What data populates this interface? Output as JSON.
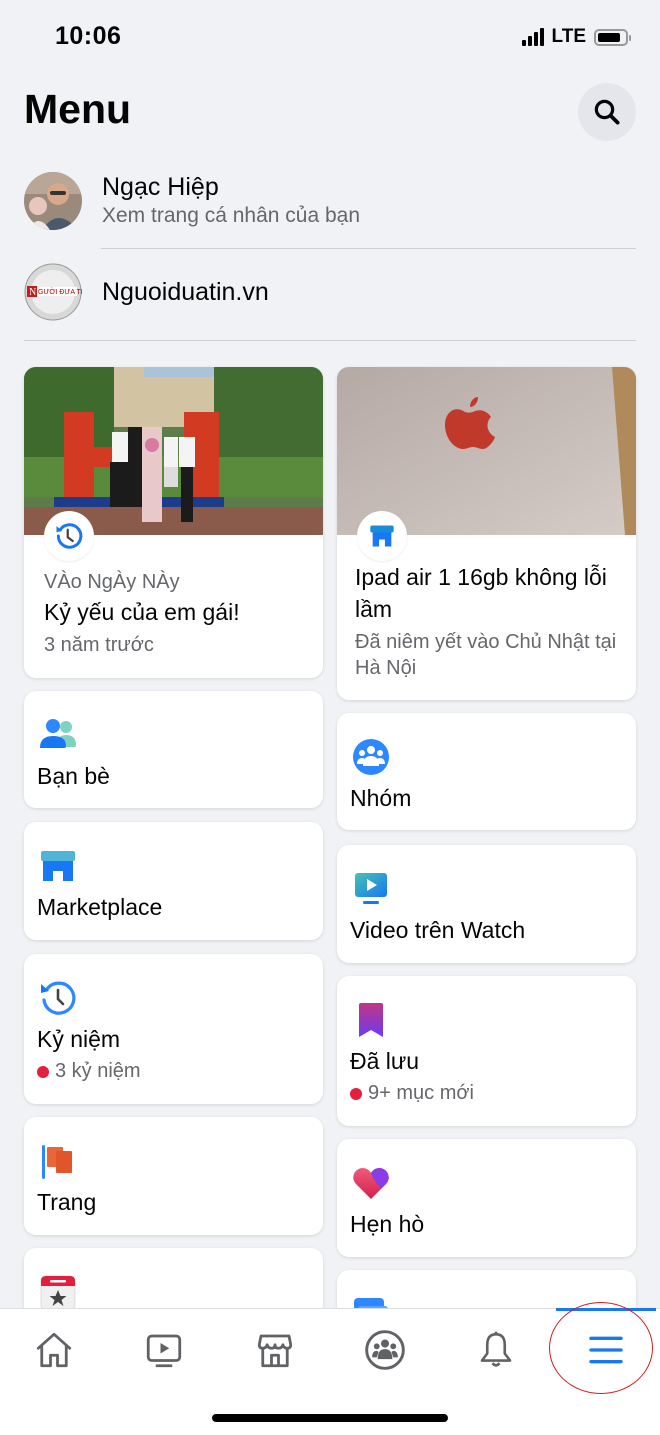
{
  "status_bar": {
    "time": "10:06",
    "network": "LTE",
    "battery_level": 0.85
  },
  "header": {
    "title": "Menu",
    "search_icon": "search-icon"
  },
  "profile": {
    "name": "Ngạc Hiệp",
    "subtitle": "Xem trang cá nhân của bạn"
  },
  "page": {
    "name": "Nguoiduatin.vn"
  },
  "featured": {
    "memory": {
      "eyebrow": "VÀo NgÀy NÀy",
      "title": "Kỷ yếu của em gái!",
      "sub": "3 năm trước",
      "icon": "memories-clock-icon"
    },
    "marketplace": {
      "title": "Ipad air 1 16gb không lỗi lầm",
      "sub": "Đã niêm yết vào Chủ Nhật tại Hà Nội",
      "icon": "marketplace-shop-icon"
    }
  },
  "shortcuts_left": [
    {
      "label": "Bạn bè",
      "icon": "friends-icon"
    },
    {
      "label": "Marketplace",
      "icon": "marketplace-icon"
    },
    {
      "label": "Kỷ niệm",
      "icon": "memories-icon",
      "sub": "3 kỷ niệm",
      "badge": true
    },
    {
      "label": "Trang",
      "icon": "pages-flag-icon"
    },
    {
      "label": "",
      "icon": "events-calendar-icon"
    }
  ],
  "shortcuts_right": [
    {
      "label": "Nhóm",
      "icon": "groups-icon"
    },
    {
      "label": "Video trên Watch",
      "icon": "watch-video-icon"
    },
    {
      "label": "Đã lưu",
      "icon": "saved-bookmark-icon",
      "sub": "9+ mục mới",
      "badge": true
    },
    {
      "label": "Hẹn hò",
      "icon": "dating-heart-icon"
    },
    {
      "label": "",
      "icon": "feeds-icon"
    }
  ],
  "tabbar": {
    "tabs": [
      "home",
      "watch",
      "marketplace",
      "groups",
      "notifications",
      "menu"
    ],
    "active": "menu"
  },
  "colors": {
    "accent": "#1877f2",
    "badge": "#e41e3f",
    "background": "#f0f2f5",
    "annotation": "#d81b1b"
  }
}
